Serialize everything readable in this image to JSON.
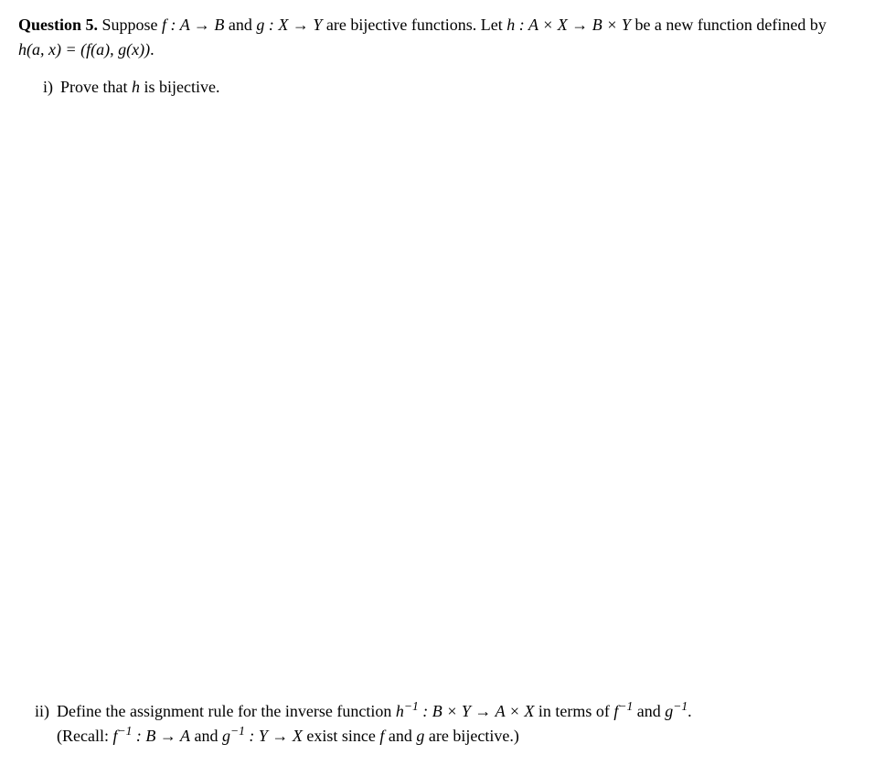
{
  "question": {
    "number": "Question 5.",
    "body_prefix": " Suppose ",
    "body_f": "f : A → B",
    "body_and1": " and ",
    "body_g": "g : X → Y",
    "body_mid": " are bijective functions. Let ",
    "body_h": "h : A × X → B × Y",
    "body_suffix": " be a new function defined by ",
    "body_def": "h(a, x) = (f(a), g(x))",
    "body_end": "."
  },
  "parts": {
    "i": {
      "label": "i)",
      "text_prefix": "Prove that ",
      "text_h": "h",
      "text_suffix": " is bijective."
    },
    "ii": {
      "label": "ii)",
      "line1_prefix": "Define the assignment rule for the inverse function ",
      "line1_hinv": "h",
      "line1_sup1": "−1",
      "line1_colon": " : B × Y → A × X",
      "line1_mid": " in terms of ",
      "line1_finv": "f",
      "line1_sup2": "−1",
      "line1_and": " and ",
      "line1_ginv": "g",
      "line1_sup3": "−1",
      "line1_end": ".",
      "line2_prefix": "(Recall: ",
      "line2_finv": "f",
      "line2_sup1": "−1",
      "line2_fcolon": " : B → A",
      "line2_and": " and ",
      "line2_ginv": "g",
      "line2_sup2": "−1",
      "line2_gcolon": " : Y → X",
      "line2_mid": " exist since ",
      "line2_f": "f",
      "line2_and2": " and ",
      "line2_g": "g",
      "line2_suffix": " are bijective.)"
    }
  }
}
